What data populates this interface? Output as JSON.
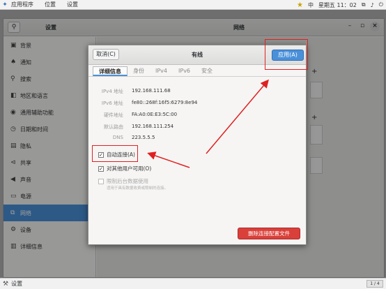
{
  "topbar": {
    "menu_apps": "应用程序",
    "menu_places": "位置",
    "menu_settings": "设置",
    "lang": "中",
    "clock": "星期五 11：02"
  },
  "settings_window": {
    "title_left": "设置",
    "title_right": "网络",
    "sidebar": [
      {
        "label": "背景",
        "icon": "background-icon"
      },
      {
        "label": "通知",
        "icon": "bell-icon"
      },
      {
        "label": "搜索",
        "icon": "search-icon"
      },
      {
        "label": "地区和语言",
        "icon": "region-icon"
      },
      {
        "label": "通用辅助功能",
        "icon": "accessibility-icon"
      },
      {
        "label": "日期和时间",
        "icon": "clock-icon"
      },
      {
        "label": "隐私",
        "icon": "privacy-icon"
      },
      {
        "label": "共享",
        "icon": "share-icon"
      },
      {
        "label": "声音",
        "icon": "sound-icon"
      },
      {
        "label": "电源",
        "icon": "power-icon"
      },
      {
        "label": "网络",
        "icon": "network-icon",
        "active": true
      },
      {
        "label": "设备",
        "icon": "devices-icon"
      },
      {
        "label": "详细信息",
        "icon": "info-icon"
      }
    ]
  },
  "dialog": {
    "cancel_label": "取消(C)",
    "title": "有线",
    "apply_label": "应用(A)",
    "tabs": [
      "详细信息",
      "身份",
      "IPv4",
      "IPv6",
      "安全"
    ],
    "details": [
      {
        "key": "IPv4 地址",
        "value": "192.168.111.68"
      },
      {
        "key": "IPv6 地址",
        "value": "fe80::268f:16f5:6279:8e94"
      },
      {
        "key": "硬件地址",
        "value": "FA:A0:0E:E3:5C:00"
      },
      {
        "key": "默认路由",
        "value": "192.168.111.254"
      },
      {
        "key": "DNS",
        "value": "223.5.5.5"
      }
    ],
    "auto_connect_label": "自动连接(A)",
    "auto_connect_checked": true,
    "all_users_label": "对其他用户可用(O)",
    "all_users_checked": true,
    "metered_label": "限制后台数据使用",
    "metered_checked": false,
    "metered_note": "适用于具有数据收费或限制的连接。",
    "delete_label": "删除连接配置文件"
  },
  "taskbar": {
    "item_label": "设置",
    "pager": "1 / 4"
  },
  "colors": {
    "accent": "#4a90d9",
    "destructive": "#d9403a",
    "annotation": "#e02020"
  }
}
